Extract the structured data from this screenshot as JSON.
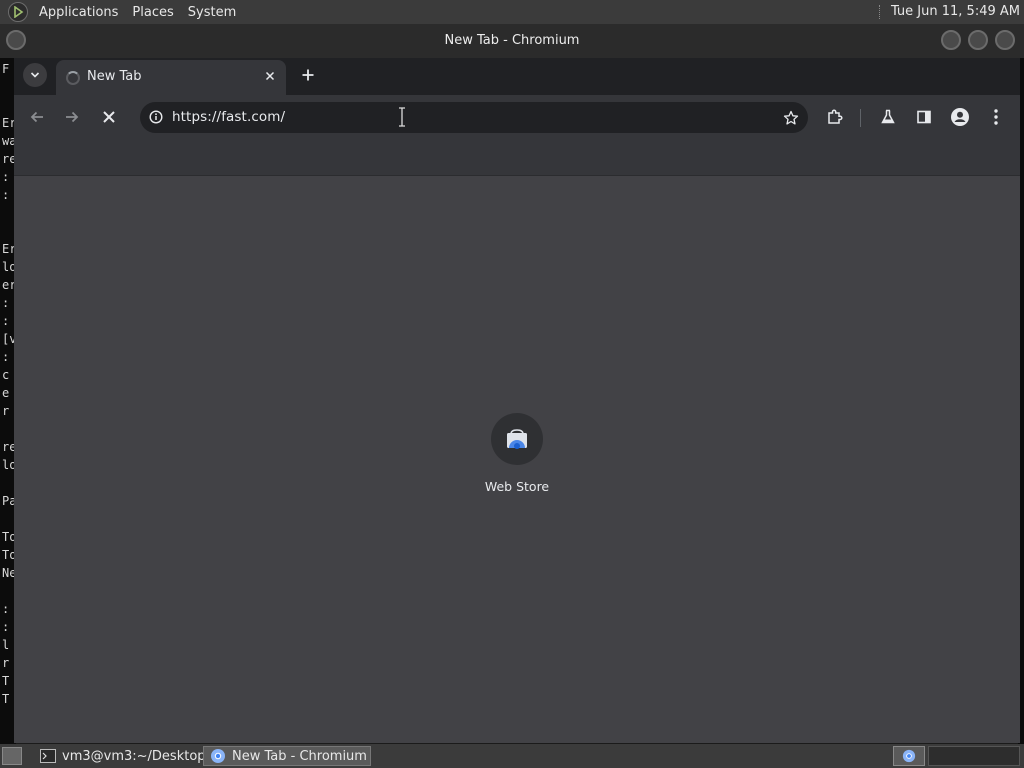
{
  "top_panel": {
    "menus": [
      "Applications",
      "Places",
      "System"
    ],
    "clock": "Tue Jun 11,  5:49 AM"
  },
  "terminal": {
    "lines": [
      "F",
      "",
      "",
      "Er",
      "wa",
      "re",
      ":",
      ":",
      "",
      "",
      "Er",
      "lo",
      "er",
      ":",
      ":",
      "[v",
      ":",
      "c",
      "e",
      "r",
      "",
      "re",
      "lo",
      "",
      "Pa",
      "",
      "To",
      "To",
      "Ne",
      "",
      ":",
      ":",
      "l",
      "r",
      "T",
      "T"
    ]
  },
  "window": {
    "title": "New Tab - Chromium"
  },
  "tabs": [
    {
      "label": "New Tab",
      "loading": true
    }
  ],
  "omnibox": {
    "url": "https://fast.com/"
  },
  "new_tab_page": {
    "shortcuts": [
      {
        "label": "Web Store",
        "icon": "webstore-icon"
      }
    ]
  },
  "taskbar": {
    "tasks": [
      {
        "label": "vm3@vm3:~/Desktop",
        "icon": "terminal-icon",
        "active": false
      },
      {
        "label": "New Tab - Chromium",
        "icon": "chromium-icon",
        "active": true
      }
    ]
  },
  "colors": {
    "panel": "#3b3b3b",
    "tabstrip": "#202124",
    "toolbar": "#35363a",
    "content": "#424246",
    "text": "#e8eaed"
  }
}
